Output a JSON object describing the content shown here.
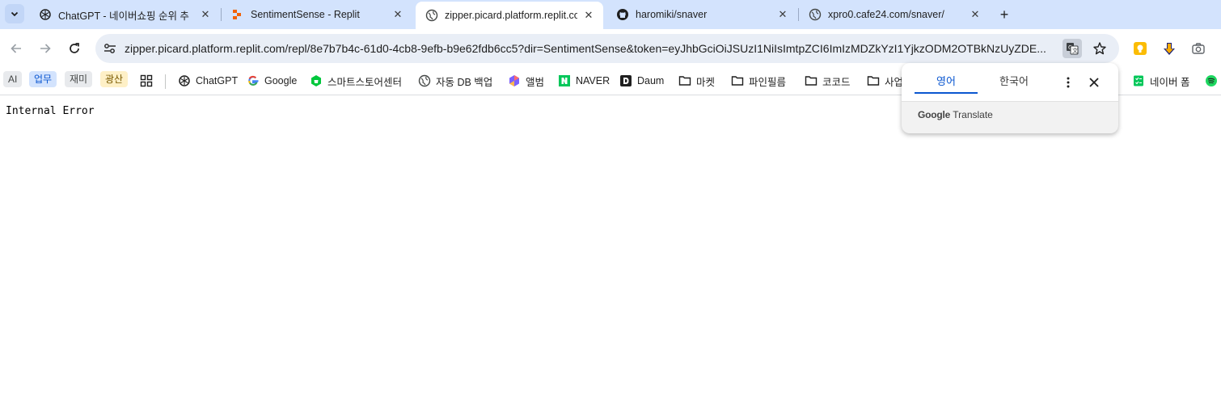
{
  "tabs": [
    {
      "title": "ChatGPT - 네이버쇼핑 순위 추",
      "icon": "chatgpt-icon",
      "active": false
    },
    {
      "title": "SentimentSense - Replit",
      "icon": "replit-icon",
      "active": false
    },
    {
      "title": "zipper.picard.platform.replit.co",
      "icon": "globe-icon",
      "active": true
    },
    {
      "title": "haromiki/snaver",
      "icon": "github-icon",
      "active": false
    },
    {
      "title": "xpro0.cafe24.com/snaver/",
      "icon": "globe-icon",
      "active": false
    }
  ],
  "omnibox": {
    "url": "zipper.picard.platform.replit.com/repl/8e7b7b4c-61d0-4cb8-9efb-b9e62fdb6cc5?dir=SentimentSense&token=eyJhbGciOiJSUzI1NiIsImtpZCI6ImIzMDZkYzI1YjkzODM2OTBkNzUyZDE..."
  },
  "bookmarks": {
    "chips": [
      {
        "label": "AI",
        "color": "#e8eaed",
        "text_color": "#444746"
      },
      {
        "label": "업무",
        "color": "#d3e3fd",
        "text_color": "#0b57d0"
      },
      {
        "label": "재미",
        "color": "#e8eaed",
        "text_color": "#444746"
      },
      {
        "label": "광산",
        "color": "#fef0c7",
        "text_color": "#7a5a00"
      }
    ],
    "items": [
      {
        "label": "ChatGPT",
        "icon": "chatgpt-icon"
      },
      {
        "label": "Google",
        "icon": "google-icon"
      },
      {
        "label": "스마트스토어센터",
        "icon": "smartstore-icon"
      },
      {
        "label": "자동 DB 백업",
        "icon": "globe-icon"
      },
      {
        "label": "앨범",
        "icon": "album-icon"
      },
      {
        "label": "NAVER",
        "icon": "naver-icon"
      },
      {
        "label": "Daum",
        "icon": "daum-icon"
      },
      {
        "label": "마켓",
        "icon": "folder-icon"
      },
      {
        "label": "파인필름",
        "icon": "folder-icon"
      },
      {
        "label": "코코드",
        "icon": "folder-icon"
      },
      {
        "label": "사업",
        "icon": "folder-icon"
      },
      {
        "label": "네이버 폼",
        "icon": "naver-form-icon"
      }
    ]
  },
  "page": {
    "text": "Internal Error"
  },
  "translate_popup": {
    "source_lang": "영어",
    "target_lang": "한국어",
    "brand_google": "Google",
    "brand_translate": "Translate"
  },
  "colors": {
    "tabstrip": "#d3e3fd",
    "omnibox": "#e9eef6",
    "accent": "#0b57d0"
  }
}
